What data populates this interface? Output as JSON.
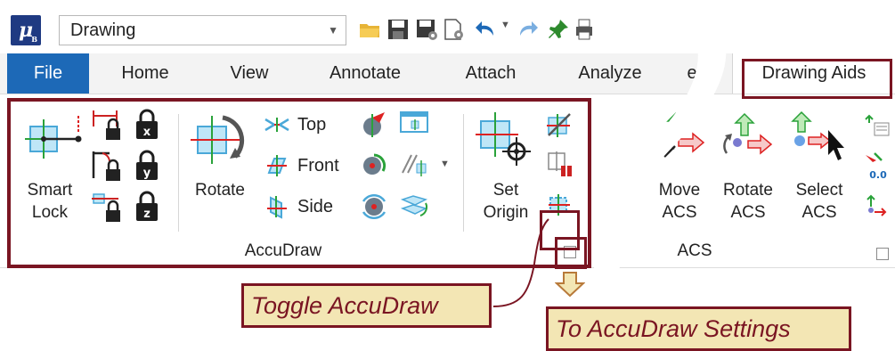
{
  "app": {
    "logo_text": "μ",
    "logo_sub": "B"
  },
  "workspace": {
    "value": "Drawing"
  },
  "tabs": [
    {
      "label": "File"
    },
    {
      "label": "Home"
    },
    {
      "label": "View"
    },
    {
      "label": "Annotate"
    },
    {
      "label": "Attach"
    },
    {
      "label": "Analyze"
    },
    {
      "label": "Drawing Aids"
    }
  ],
  "tab_partial": "es",
  "accudraw_group": {
    "label": "AccuDraw",
    "smart_lock": {
      "line1": "Smart",
      "line2": "Lock"
    },
    "rotate": {
      "label": "Rotate"
    },
    "top": {
      "label": "Top"
    },
    "front": {
      "label": "Front"
    },
    "side": {
      "label": "Side"
    },
    "set_origin": {
      "line1": "Set",
      "line2": "Origin"
    }
  },
  "acs_group": {
    "label": "ACS",
    "move": {
      "line1": "Move",
      "line2": "ACS"
    },
    "rotate": {
      "line1": "Rotate",
      "line2": "ACS"
    },
    "select": {
      "line1": "Select",
      "line2": "ACS"
    },
    "small_value": "0.0"
  },
  "callouts": {
    "toggle": "Toggle AccuDraw",
    "settings": "To AccuDraw Settings"
  },
  "colors": {
    "accent": "#7a1522",
    "file_tab": "#1d69b7",
    "callout_bg": "#f3e6b4"
  }
}
